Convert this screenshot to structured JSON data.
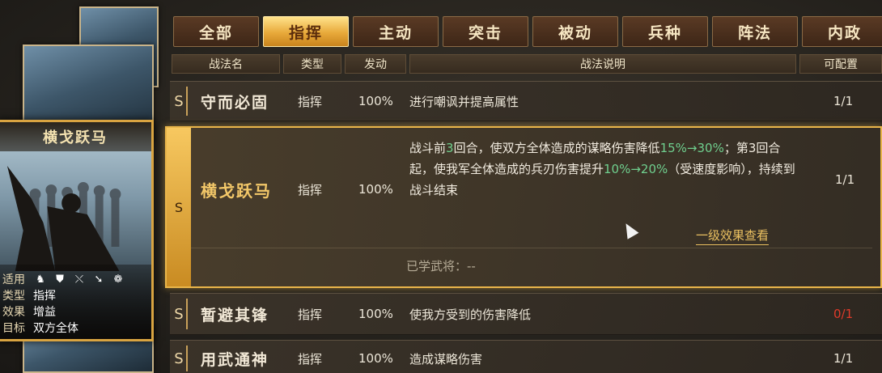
{
  "general_card": {
    "name": "横戈跃马",
    "info": {
      "applicable_label": "适用",
      "applicable_troops": [
        "cavalry-icon",
        "shield-icon",
        "bow-icon",
        "spear-icon",
        "wheel-icon"
      ],
      "type_label": "类型",
      "type_value": "指挥",
      "effect_label": "效果",
      "effect_value": "增益",
      "target_label": "目标",
      "target_value": "双方全体"
    }
  },
  "tabs": [
    {
      "label": "全部",
      "active": false
    },
    {
      "label": "指挥",
      "active": true
    },
    {
      "label": "主动",
      "active": false
    },
    {
      "label": "突击",
      "active": false
    },
    {
      "label": "被动",
      "active": false
    },
    {
      "label": "兵种",
      "active": false
    },
    {
      "label": "阵法",
      "active": false
    },
    {
      "label": "内政",
      "active": false
    }
  ],
  "columns": {
    "name": "战法名",
    "type": "类型",
    "rate": "发动",
    "desc": "战法说明",
    "count": "可配置"
  },
  "rows": [
    {
      "grade": "S",
      "name": "守而必固",
      "type": "指挥",
      "rate": "100%",
      "desc": "进行嘲讽并提高属性",
      "count": "1/1",
      "count_color": "#ece6d8"
    },
    {
      "grade": "S",
      "name": "横戈跃马",
      "type": "指挥",
      "rate": "100%",
      "desc_parts": [
        {
          "t": "战斗前",
          "hl": false
        },
        {
          "t": "3",
          "hl": true
        },
        {
          "t": "回合，使双方全体造成的谋略伤害降低",
          "hl": false
        },
        {
          "t": "15%→30%",
          "hl": true
        },
        {
          "t": "；第3回合起，使我军全体造成的兵刃伤害提升",
          "hl": false
        },
        {
          "t": "10%→20%",
          "hl": true
        },
        {
          "t": "（受速度影响），持续到战斗结束",
          "hl": false
        }
      ],
      "detail_link": "一级效果查看",
      "learned": "已学武将：--",
      "count": "1/1"
    },
    {
      "grade": "S",
      "name": "暂避其锋",
      "type": "指挥",
      "rate": "100%",
      "desc": "使我方受到的伤害降低",
      "count": "0/1",
      "count_color": "#e03a2a"
    },
    {
      "grade": "S",
      "name": "用武通神",
      "type": "指挥",
      "rate": "100%",
      "desc": "造成谋略伤害",
      "count": "1/1",
      "count_color": "#ece6d8"
    }
  ],
  "colors": {
    "accent_gold": "#e9b54a",
    "highlight_green": "#6fcf8e",
    "count_red": "#e03a2a"
  }
}
